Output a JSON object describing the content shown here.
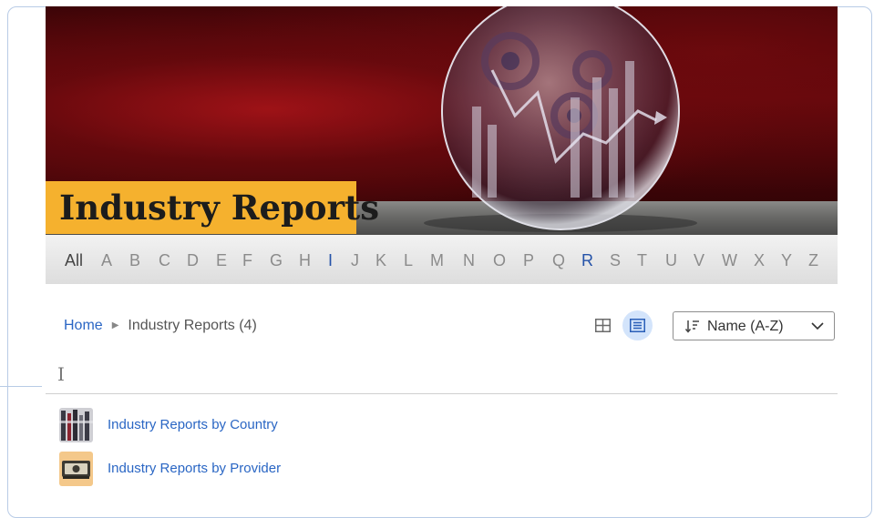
{
  "banner": {
    "title": "Industry Reports",
    "image": "crystal-ball-with-gears-and-charts-illustration"
  },
  "alphabet": {
    "all_label": "All",
    "letters": [
      "A",
      "B",
      "C",
      "D",
      "E",
      "F",
      "G",
      "H",
      "I",
      "J",
      "K",
      "L",
      "M",
      "N",
      "O",
      "P",
      "Q",
      "R",
      "S",
      "T",
      "U",
      "V",
      "W",
      "X",
      "Y",
      "Z"
    ],
    "active_letters": [
      "I",
      "R"
    ]
  },
  "breadcrumb": {
    "home": "Home",
    "current": "Industry Reports (4)"
  },
  "view_toggle": {
    "grid_icon": "grid-view-icon",
    "list_icon": "list-view-icon",
    "selected": "list"
  },
  "sort": {
    "icon": "sort-icon",
    "label": "Name (A-Z)",
    "chevron": "chevron-down-icon"
  },
  "section_letter": "I",
  "items": [
    {
      "label": "Industry Reports by Country",
      "thumb": "building-columns-thumbnail"
    },
    {
      "label": "Industry Reports by Provider",
      "thumb": "money-stack-thumbnail"
    }
  ],
  "colors": {
    "accent": "#2a66c4",
    "active_letter": "#2452a8",
    "banner_title_bg": "#f5b12e",
    "view_selected_bg": "#d3e4fb"
  }
}
